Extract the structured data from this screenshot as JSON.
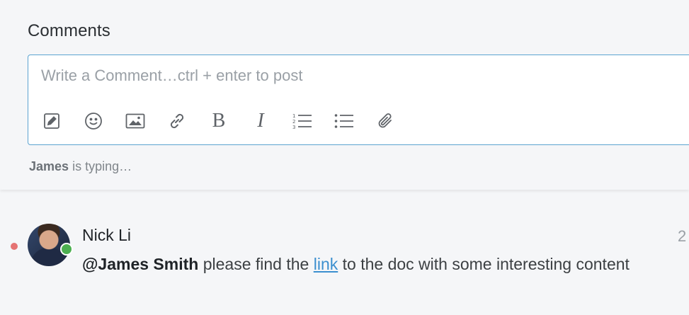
{
  "comments_section": {
    "title": "Comments",
    "editor": {
      "placeholder": "Write a Comment…ctrl + enter to post",
      "value": "",
      "toolbar": [
        {
          "name": "edit-icon"
        },
        {
          "name": "emoji-icon"
        },
        {
          "name": "image-icon"
        },
        {
          "name": "link-icon"
        },
        {
          "name": "bold-icon",
          "label": "B"
        },
        {
          "name": "italic-icon",
          "label": "I"
        },
        {
          "name": "ordered-list-icon"
        },
        {
          "name": "bullet-list-icon"
        },
        {
          "name": "attachment-icon"
        }
      ]
    },
    "typing_indicator": {
      "user": "James",
      "text": " is typing…"
    }
  },
  "comments": [
    {
      "author": "Nick Li",
      "time": "2",
      "unread": true,
      "online": true,
      "mention": "@James Smith",
      "text_before_link": " please find the ",
      "link_text": "link",
      "text_after_link": " to the doc with some interesting content"
    }
  ],
  "colors": {
    "accent_border": "#5ba3d0",
    "link": "#3b8fcf",
    "unread_dot": "#e57373",
    "online": "#4caf50"
  }
}
